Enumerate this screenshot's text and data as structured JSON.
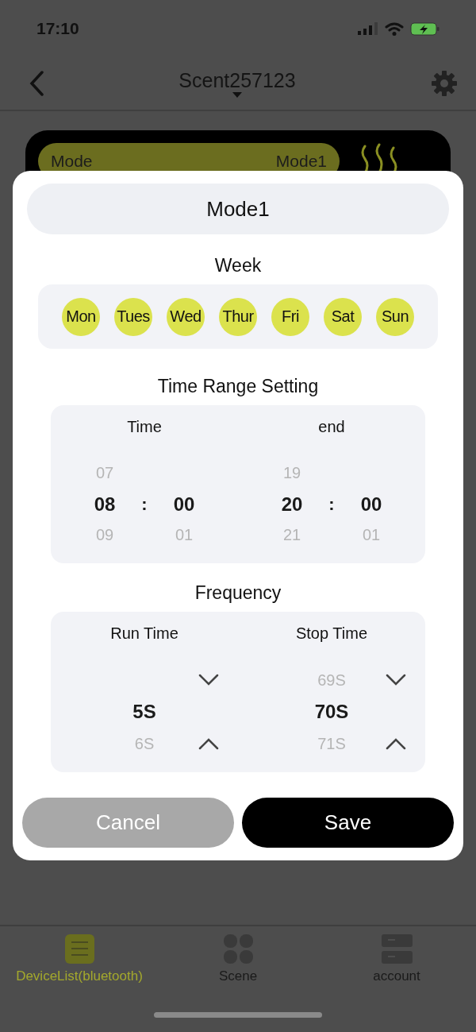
{
  "status_bar": {
    "time": "17:10"
  },
  "nav": {
    "title": "Scent257123"
  },
  "mode_card": {
    "label": "Mode",
    "value": "Mode1"
  },
  "dialog": {
    "title": "Mode1",
    "week_heading": "Week",
    "days": [
      {
        "label": "Mon",
        "selected": true
      },
      {
        "label": "Tues",
        "selected": true
      },
      {
        "label": "Wed",
        "selected": true
      },
      {
        "label": "Thur",
        "selected": true
      },
      {
        "label": "Fri",
        "selected": true
      },
      {
        "label": "Sat",
        "selected": true
      },
      {
        "label": "Sun",
        "selected": true
      }
    ],
    "time_range": {
      "heading": "Time Range Setting",
      "columns": [
        {
          "label": "Time",
          "separator": ":",
          "hour": {
            "above": "07",
            "value": "08",
            "below": "09"
          },
          "minute": {
            "value": "00",
            "below": "01"
          }
        },
        {
          "label": "end",
          "separator": ":",
          "hour": {
            "above": "19",
            "value": "20",
            "below": "21"
          },
          "minute": {
            "value": "00",
            "below": "01"
          }
        }
      ]
    },
    "frequency": {
      "heading": "Frequency",
      "columns": [
        {
          "label": "Run Time",
          "value": "5S",
          "below": "6S"
        },
        {
          "label": "Stop Time",
          "above": "69S",
          "value": "70S",
          "below": "71S"
        }
      ]
    },
    "buttons": [
      {
        "label": "Cancel",
        "kind": "secondary"
      },
      {
        "label": "Save",
        "kind": "primary"
      }
    ]
  },
  "tab_bar": [
    {
      "label": "DeviceList(bluetooth)",
      "selected": true
    },
    {
      "label": "Scene",
      "selected": false
    },
    {
      "label": "account",
      "selected": false
    }
  ]
}
